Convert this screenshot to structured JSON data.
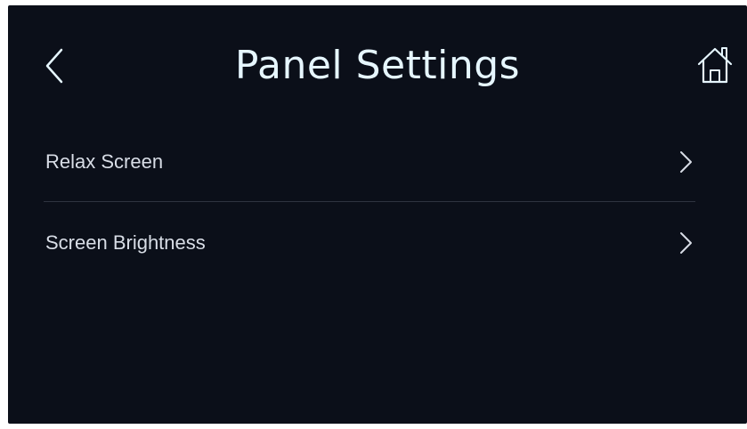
{
  "header": {
    "title": "Panel Settings",
    "back_icon": "chevron-left-icon",
    "home_icon": "home-icon"
  },
  "settings": {
    "items": [
      {
        "label": "Relax Screen",
        "icon": "chevron-right-icon"
      },
      {
        "label": "Screen Brightness",
        "icon": "chevron-right-icon"
      }
    ]
  },
  "colors": {
    "background": "#0b0f19",
    "title": "#e6f6ff",
    "text": "#d8dde6",
    "divider": "#2f3440"
  }
}
